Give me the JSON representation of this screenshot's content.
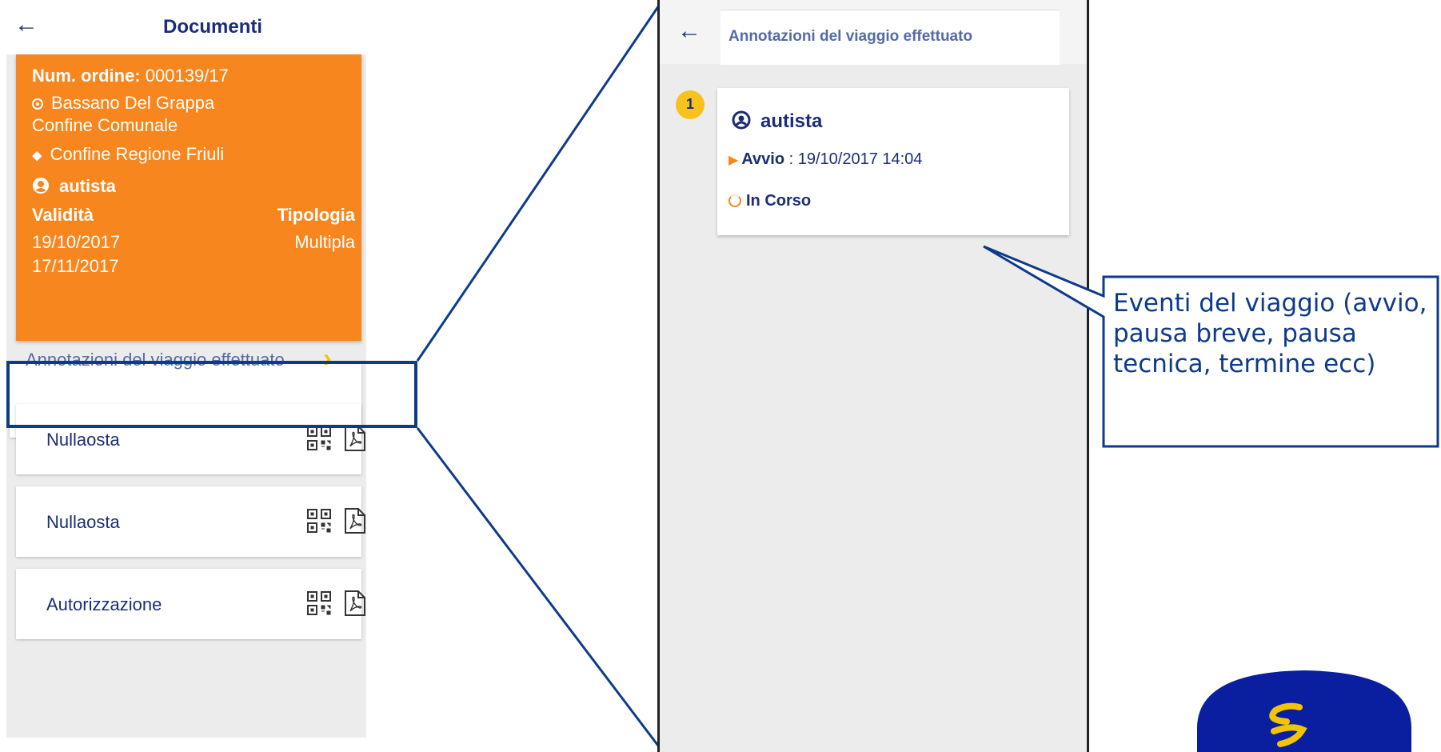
{
  "left_screen": {
    "back_icon": "arrow-left-icon",
    "title": "Documenti",
    "order_card": {
      "order_label": "Num. ordine:",
      "order_number": "000139/17",
      "origin_line1": "Bassano Del Grappa",
      "origin_line2": "Confine Comunale",
      "destination": "Confine Regione Friuli",
      "user": "autista",
      "validity_label": "Validità",
      "type_label": "Tipologia",
      "valid_from": "19/10/2017",
      "valid_to": "17/11/2017",
      "type_value": "Multipla"
    },
    "annotations_row": {
      "label": "Annotazioni del viaggio effettuato",
      "chevron": "›"
    },
    "documents": [
      {
        "label": "Nullaosta"
      },
      {
        "label": "Nullaosta"
      },
      {
        "label": "Autorizzazione"
      }
    ]
  },
  "right_screen": {
    "back_icon": "arrow-left-icon",
    "title": "Annotazioni del viaggio effettuato",
    "event": {
      "badge": "1",
      "user": "autista",
      "start_label": "Avvio",
      "start_value": " : 19/10/2017 14:04",
      "status": "In Corso"
    }
  },
  "callout": {
    "text": "Eventi del viaggio (avvio, pausa breve, pausa tecnica, termine ecc)"
  },
  "colors": {
    "orange": "#f7861e",
    "navy": "#1b2d78",
    "frame_blue": "#0d3a8a",
    "yellow": "#f7c21c",
    "background": "#ececec"
  }
}
